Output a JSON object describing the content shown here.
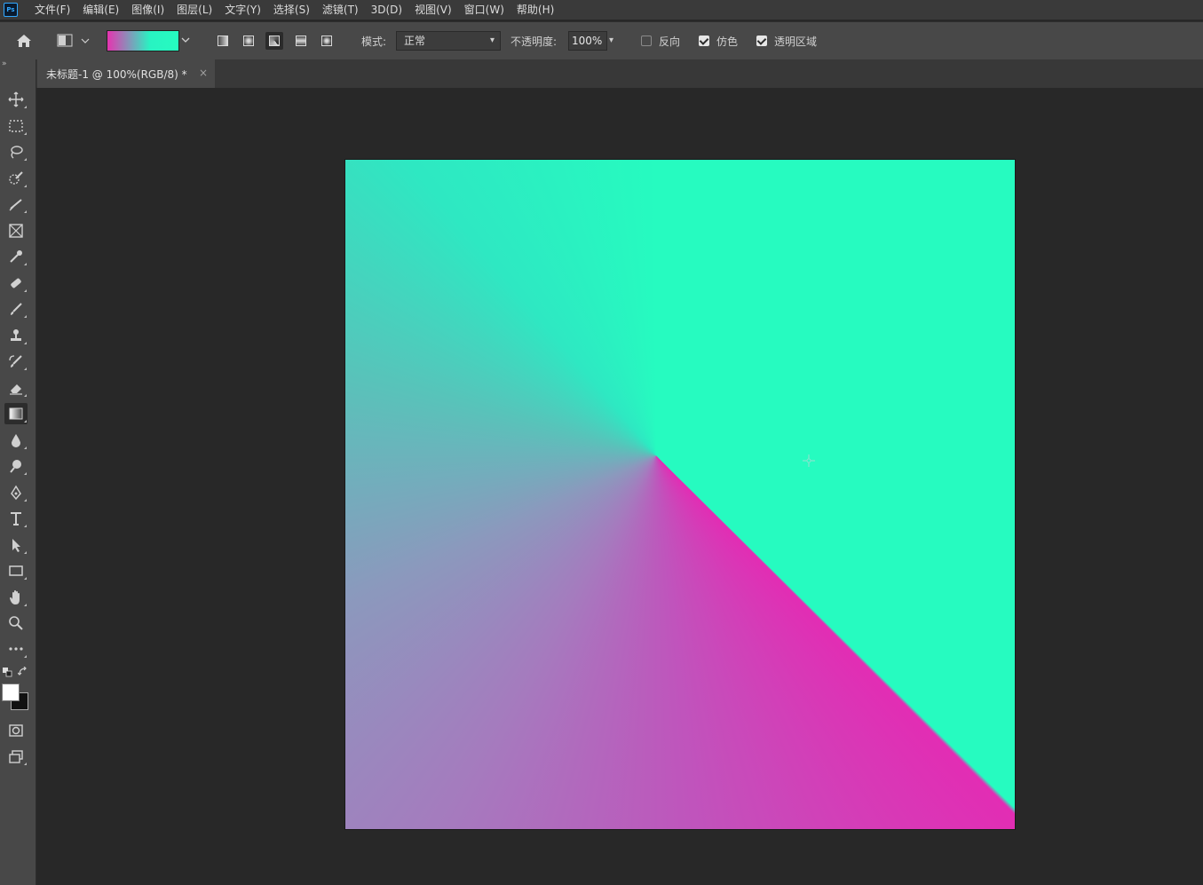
{
  "menubar": {
    "app_logo": "Ps",
    "items": [
      "文件(F)",
      "编辑(E)",
      "图像(I)",
      "图层(L)",
      "文字(Y)",
      "选择(S)",
      "滤镜(T)",
      "3D(D)",
      "视图(V)",
      "窗口(W)",
      "帮助(H)"
    ]
  },
  "options": {
    "gradient_colors": [
      "#e534b0",
      "#26fbc0"
    ],
    "active_gradient_type": "angle",
    "mode_label": "模式:",
    "mode_value": "正常",
    "opacity_label": "不透明度:",
    "opacity_value": "100%",
    "reverse_label": "反向",
    "reverse_checked": false,
    "dither_label": "仿色",
    "dither_checked": true,
    "transparency_label": "透明区域",
    "transparency_checked": true
  },
  "toolbar": {
    "active_tool": "gradient-tool",
    "foreground_color": "#ffffff",
    "background_color": "#111111"
  },
  "document": {
    "tab_title": "未标题-1 @ 100%(RGB/8) *",
    "close_glyph": "×",
    "canvas_gradient": {
      "type": "angle",
      "colors": [
        "#e22db4",
        "#26fbc0"
      ]
    }
  }
}
